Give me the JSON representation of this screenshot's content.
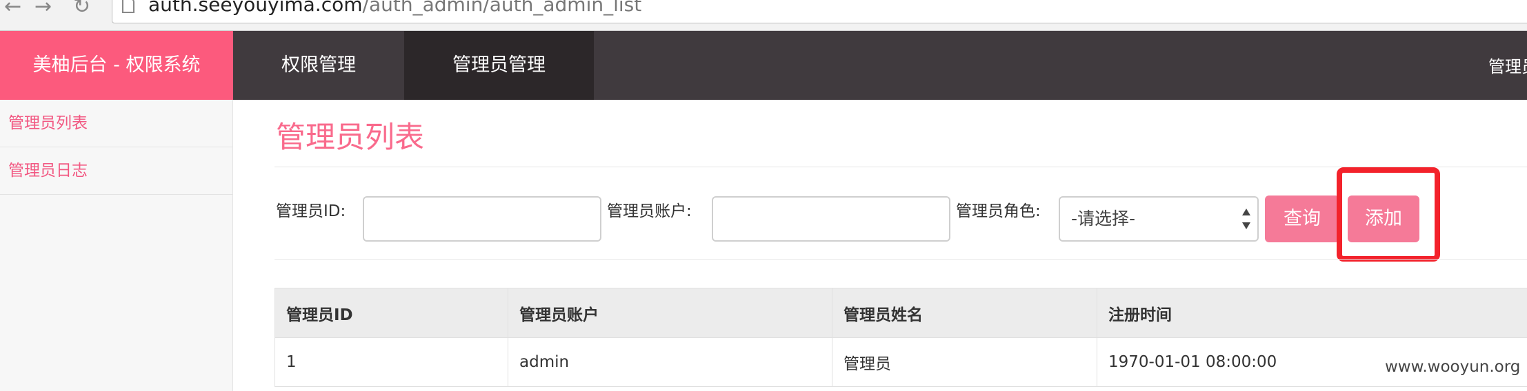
{
  "browser": {
    "url_host": "auth.seeyouyima.com",
    "url_path": "/auth_admin/auth_admin_list"
  },
  "header": {
    "brand": "美柚后台 - 权限系统",
    "nav": [
      "权限管理",
      "管理员管理"
    ],
    "active_nav": "管理员管理",
    "user_text": "管理员"
  },
  "sidebar": {
    "items": [
      {
        "label": "管理员列表"
      },
      {
        "label": "管理员日志"
      }
    ]
  },
  "main": {
    "title": "管理员列表",
    "filters": {
      "admin_id_label": "管理员ID:",
      "admin_id_value": "",
      "account_label": "管理员账户:",
      "account_value": "",
      "role_label": "管理员角色:",
      "role_selected": "-请选择-"
    },
    "buttons": {
      "query": "查询",
      "add": "添加"
    },
    "table": {
      "columns": [
        "管理员ID",
        "管理员账户",
        "管理员姓名",
        "注册时间"
      ],
      "rows": [
        [
          "1",
          "admin",
          "管理员",
          "1970-01-01 08:00:00"
        ]
      ]
    }
  },
  "watermark": "www.wooyun.org",
  "colors": {
    "brand_pink": "#fc5a7d",
    "header_dark": "#403a3e",
    "button_pink": "#f57a98",
    "highlight_red": "#f3222b"
  }
}
